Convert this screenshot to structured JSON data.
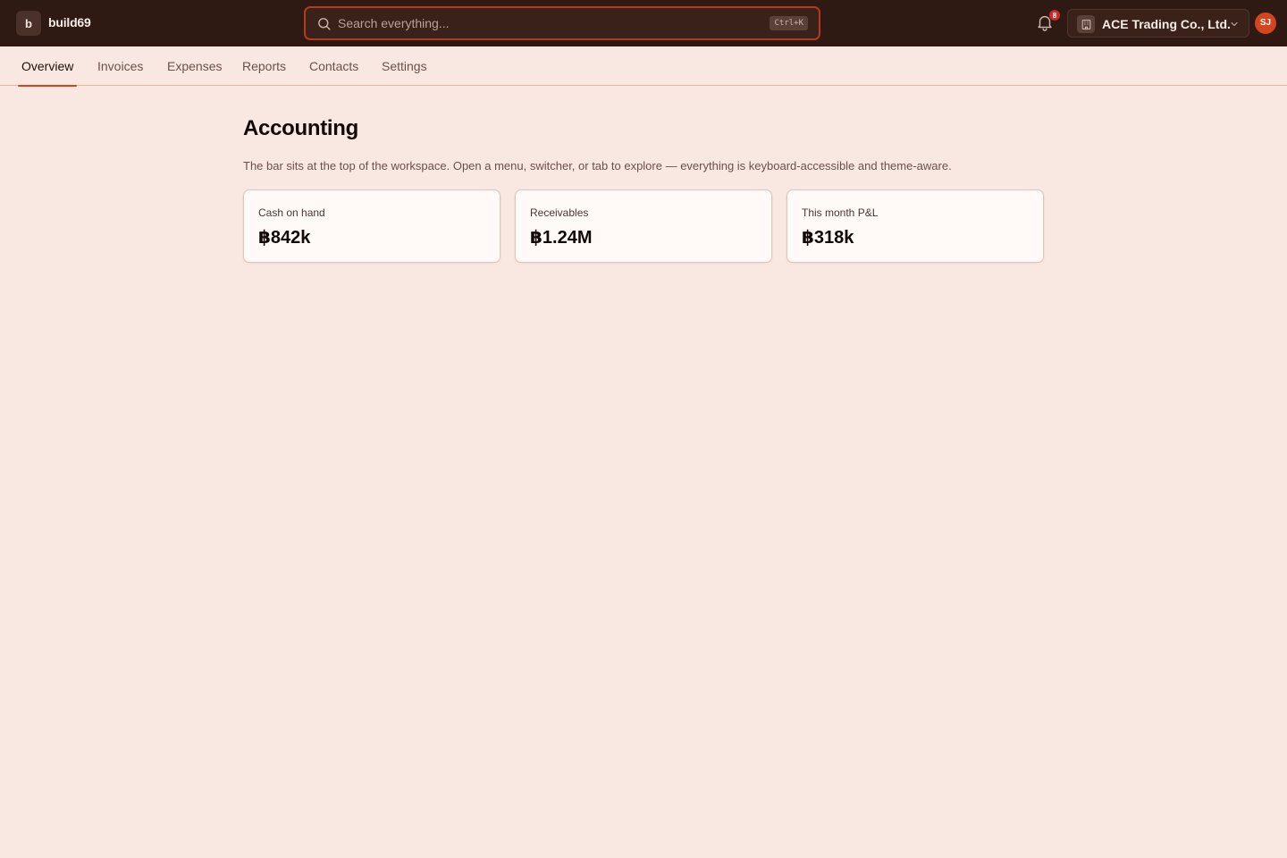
{
  "brand": {
    "badge": "b",
    "name": "build69"
  },
  "search": {
    "placeholder": "Search everything...",
    "shortcut": "Ctrl+K"
  },
  "notifications": {
    "count": "8"
  },
  "org": {
    "name": "ACE Trading Co., Ltd."
  },
  "user": {
    "initials": "SJ"
  },
  "tabs": [
    {
      "label": "Overview",
      "active": true
    },
    {
      "label": "Invoices"
    },
    {
      "label": "Expenses"
    },
    {
      "label": "Reports"
    },
    {
      "label": "Contacts"
    },
    {
      "label": "Settings"
    }
  ],
  "page": {
    "title": "Accounting",
    "description": "The bar sits at the top of the workspace. Open a menu, switcher, or tab to explore — everything is keyboard-accessible and theme-aware."
  },
  "cards": [
    {
      "label": "Cash on hand",
      "value": "฿842k"
    },
    {
      "label": "Receivables",
      "value": "฿1.24M"
    },
    {
      "label": "This month P&L",
      "value": "฿318k"
    }
  ],
  "colors": {
    "topbar": "#2e1913",
    "accent": "#d2451e",
    "background": "#f9e8e1",
    "card": "#fffaf7",
    "badge": "#c92a2a"
  }
}
